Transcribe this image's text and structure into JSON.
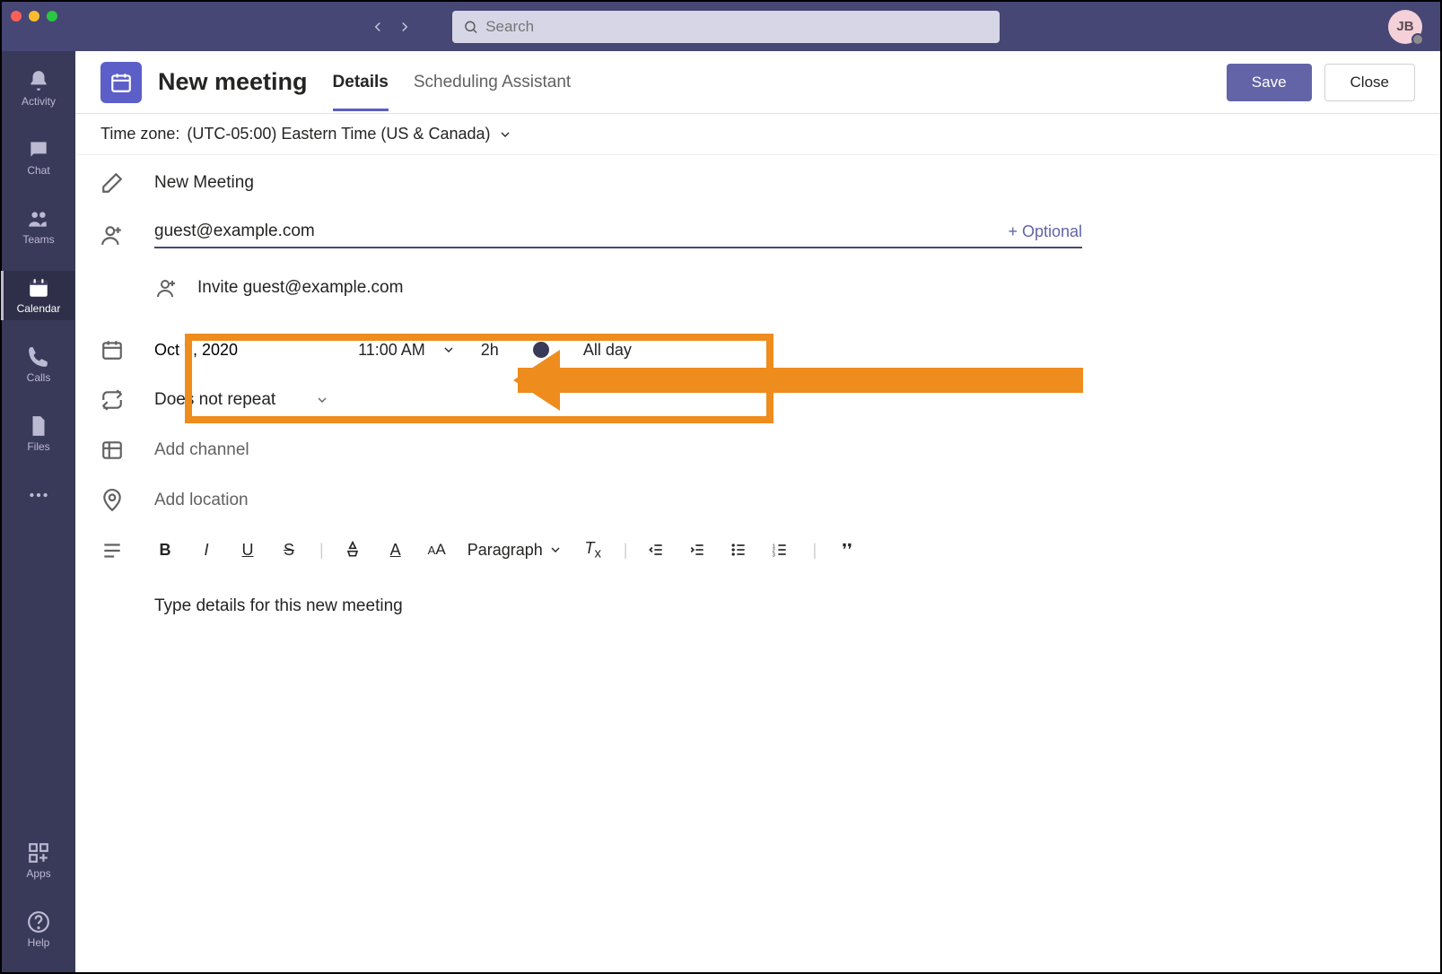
{
  "avatar": {
    "initials": "JB"
  },
  "search": {
    "placeholder": "Search"
  },
  "rail": {
    "items": [
      {
        "label": "Activity"
      },
      {
        "label": "Chat"
      },
      {
        "label": "Teams"
      },
      {
        "label": "Calendar"
      },
      {
        "label": "Calls"
      },
      {
        "label": "Files"
      }
    ],
    "apps": "Apps",
    "help": "Help"
  },
  "header": {
    "title": "New meeting",
    "tabs": {
      "details": "Details",
      "scheduling": "Scheduling Assistant"
    },
    "save": "Save",
    "close": "Close"
  },
  "timezone": {
    "label": "Time zone:",
    "value": "(UTC-05:00) Eastern Time (US & Canada)"
  },
  "meeting": {
    "title": "New Meeting",
    "attendee": "guest@example.com",
    "optional": "+ Optional",
    "invite_suggestion": "Invite guest@example.com",
    "date": "Oct 7, 2020",
    "time": "11:00 AM",
    "duration": "2h",
    "allday": "All day",
    "repeat": "Does not repeat",
    "channel_placeholder": "Add channel",
    "location_placeholder": "Add location",
    "details_placeholder": "Type details for this new meeting"
  },
  "toolbar": {
    "paragraph": "Paragraph"
  }
}
